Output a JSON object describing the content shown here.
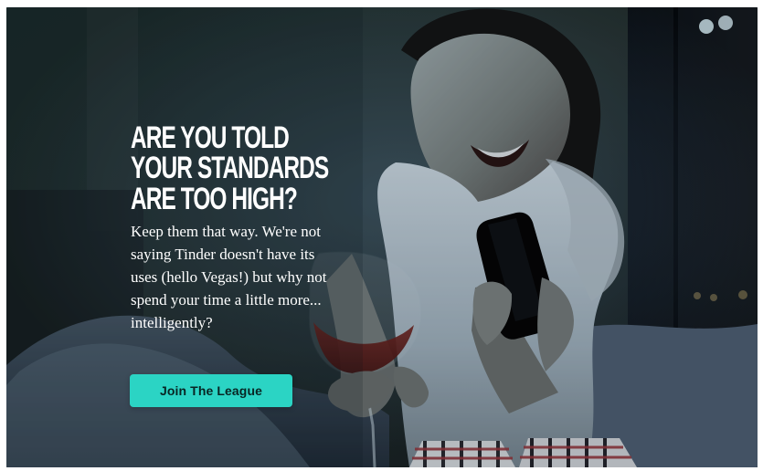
{
  "hero": {
    "headline": "ARE YOU TOLD\nYOUR STANDARDS\nARE TOO HIGH?",
    "body": "Keep them that way. We're not\nsaying Tinder doesn't have its\nuses (hello Vegas!) but why not\nspend your time a little more...\nintelligently?",
    "cta_label": "Join The League"
  },
  "colors": {
    "accent": "#2bd4c4",
    "headline_text": "#ffffff",
    "body_text": "#ffffff"
  }
}
